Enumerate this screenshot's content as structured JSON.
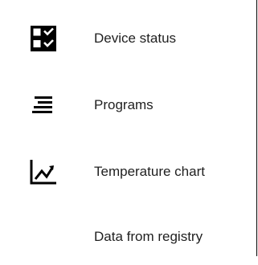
{
  "menu": {
    "items": [
      {
        "label": "Device status",
        "icon": "checklist-icon"
      },
      {
        "label": "Programs",
        "icon": "lines-icon"
      },
      {
        "label": "Temperature chart",
        "icon": "line-chart-icon"
      },
      {
        "label": "Data from registry",
        "icon": ""
      }
    ]
  },
  "colors": {
    "text": "#1f1f1f",
    "icon": "#000000",
    "border": "#000000",
    "background": "#ffffff"
  }
}
